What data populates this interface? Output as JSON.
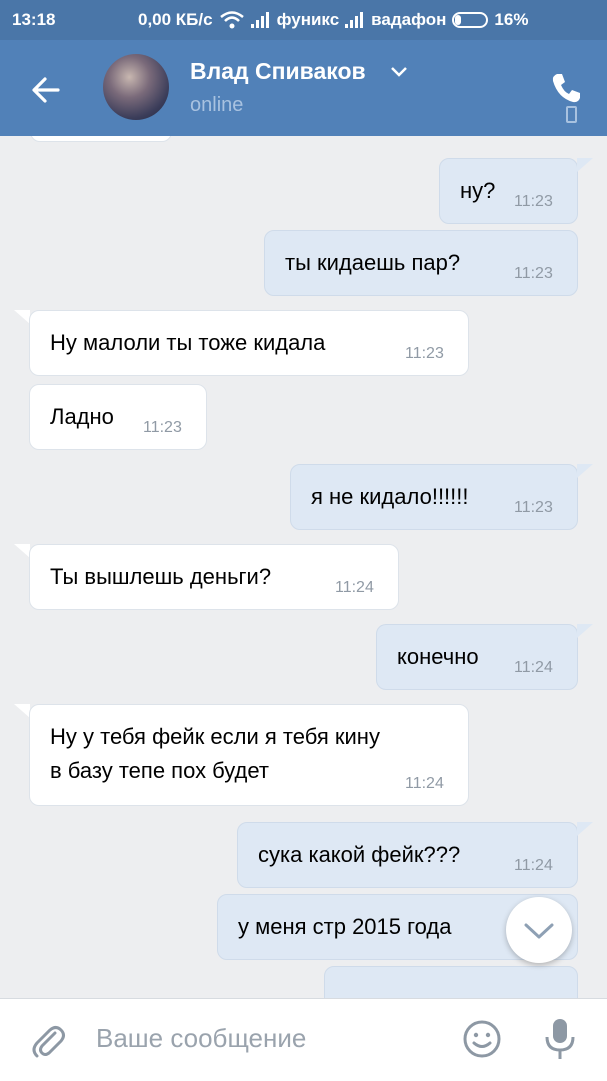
{
  "status_bar": {
    "time": "13:18",
    "speed": "0,00 КБ/с",
    "carrier1": "фуникс",
    "carrier2": "вадафон",
    "battery": "16%"
  },
  "header": {
    "contact_name": "Влад Спиваков",
    "status": "online"
  },
  "messages": [
    {
      "dir": "out",
      "text": "ну?",
      "time": "11:23"
    },
    {
      "dir": "out",
      "text": "ты кидаешь пар?",
      "time": "11:23"
    },
    {
      "dir": "in",
      "text": "Ну малоли ты тоже кидала",
      "time": "11:23"
    },
    {
      "dir": "in",
      "text": "Ладно",
      "time": "11:23"
    },
    {
      "dir": "out",
      "text": "я не кидало!!!!!!",
      "time": "11:23"
    },
    {
      "dir": "in",
      "text": "Ты вышлешь деньги?",
      "time": "11:24"
    },
    {
      "dir": "out",
      "text": "конечно",
      "time": "11:24"
    },
    {
      "dir": "in",
      "text": "Ну у тебя фейк если я тебя кину\nв базу тепе пох будет",
      "time": "11:24"
    },
    {
      "dir": "out",
      "text": "сука какой фейк???",
      "time": "11:24"
    },
    {
      "dir": "out",
      "text": "у меня стр 2015 года",
      "time": ""
    }
  ],
  "composer": {
    "placeholder": "Ваше сообщение"
  },
  "colors": {
    "header_bg": "#5181b8",
    "status_bg": "#4a76a8",
    "chat_bg": "#edeef0",
    "outgoing_bubble": "#dee8f4",
    "incoming_bubble": "#ffffff"
  },
  "icons": [
    "back-arrow-icon",
    "chevron-down-icon",
    "phone-call-icon",
    "mobile-device-icon",
    "paperclip-icon",
    "smile-icon",
    "microphone-icon",
    "scroll-down-icon"
  ]
}
